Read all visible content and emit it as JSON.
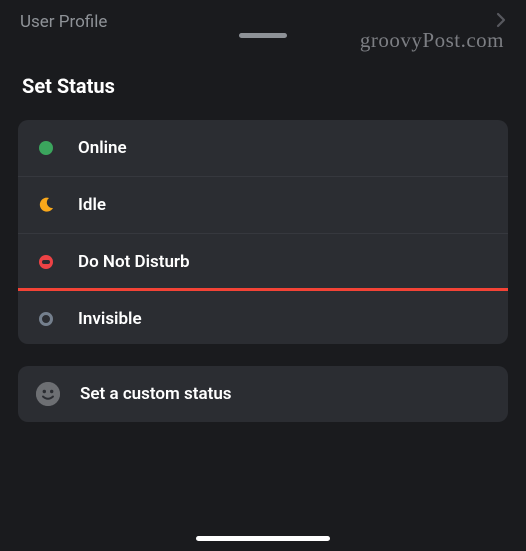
{
  "header": {
    "title": "User Profile"
  },
  "sheet": {
    "title": "Set Status"
  },
  "statuses": {
    "online": "Online",
    "idle": "Idle",
    "dnd": "Do Not Disturb",
    "invisible": "Invisible"
  },
  "custom": {
    "label": "Set a custom status"
  },
  "watermark": "groovyPost.com",
  "colors": {
    "online": "#3ba55d",
    "idle": "#faa81a",
    "dnd": "#ed4245",
    "invisible": "#747f8d",
    "highlight": "#f44336"
  }
}
